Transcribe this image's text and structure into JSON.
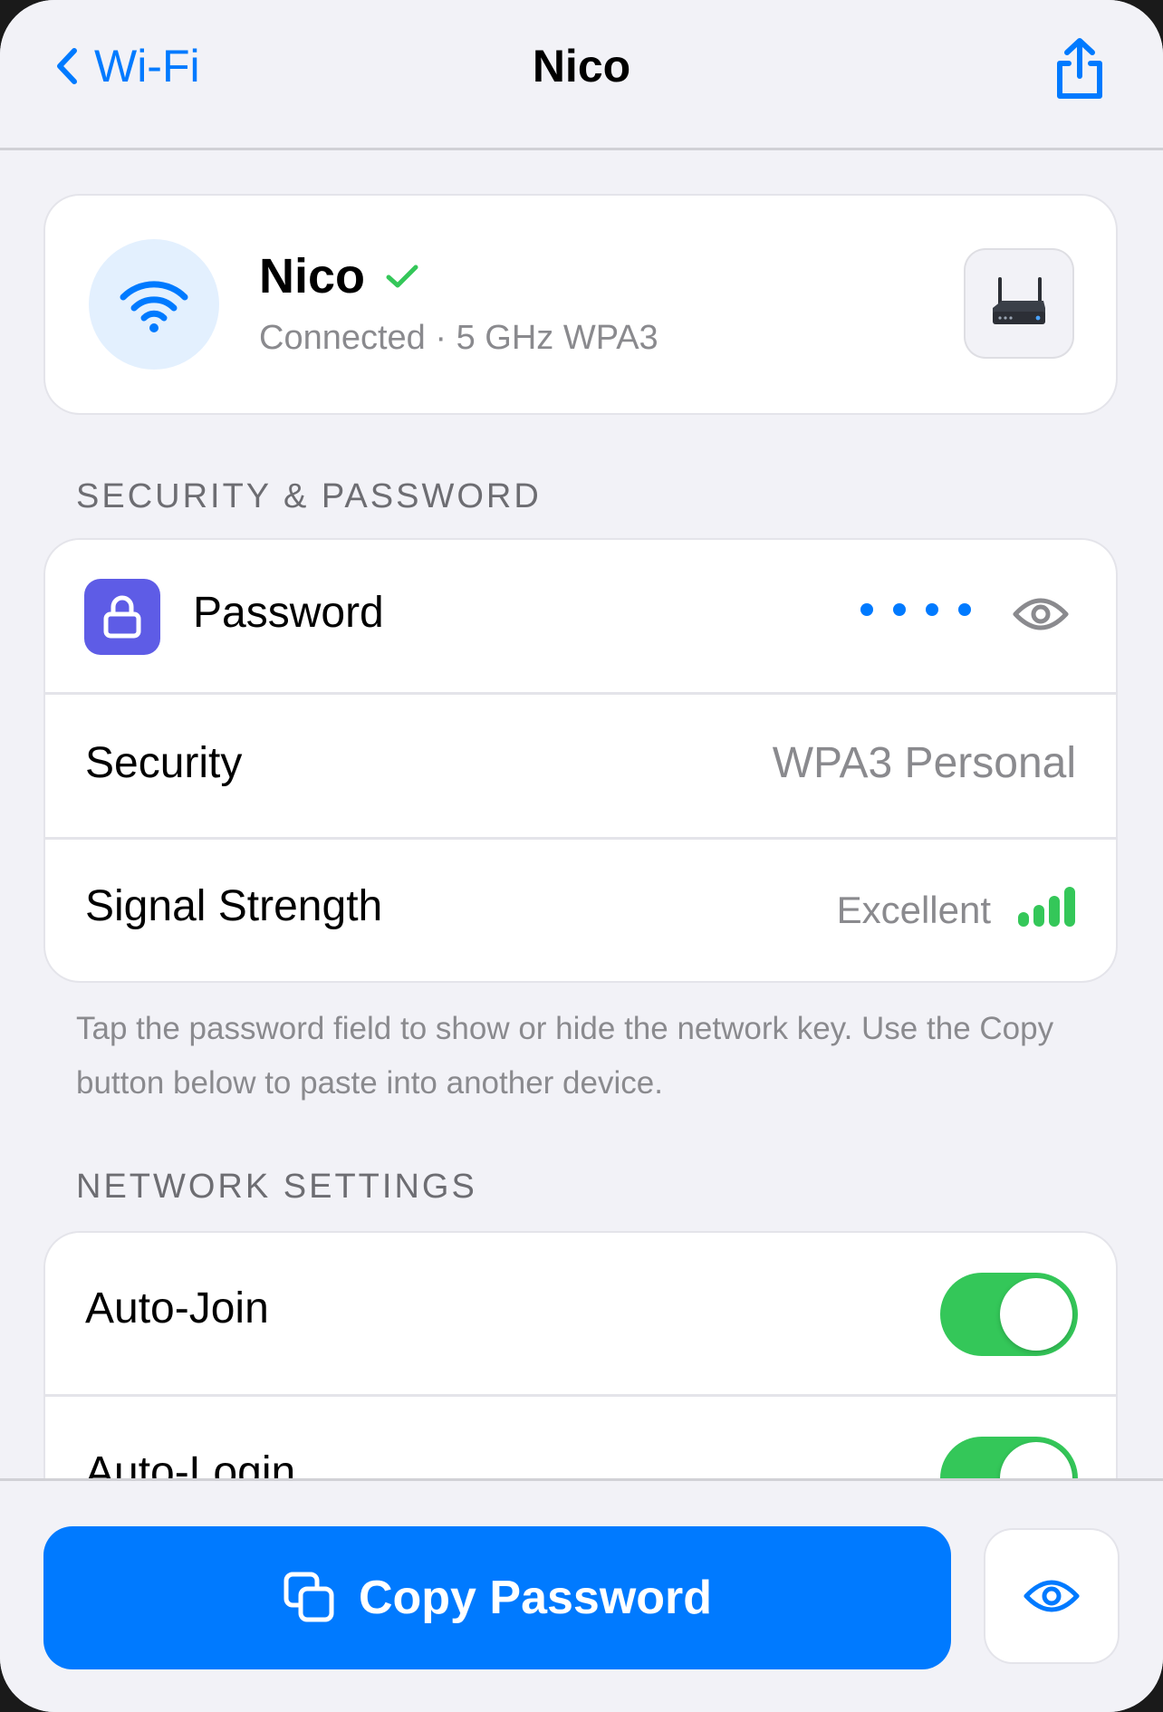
{
  "nav": {
    "back_label": "Wi-Fi",
    "title": "Nico"
  },
  "network": {
    "name": "Nico",
    "subtitle": "Connected · 5 GHz WPA3"
  },
  "security_section": {
    "title": "SECURITY & PASSWORD",
    "password_label": "Password",
    "security_label": "Security",
    "security_value": "WPA3 Personal",
    "signal_label": "Signal Strength",
    "signal_value": "Excellent",
    "signal_bars": 4,
    "footnote": "Tap the password field to show or hide the network key. Use the Copy button below to paste into another device."
  },
  "network_section": {
    "title": "NETWORK SETTINGS",
    "auto_join_label": "Auto-Join",
    "auto_join_on": true,
    "auto_login_label": "Auto-Login",
    "auto_login_on": true
  },
  "bottom": {
    "copy_label": "Copy Password"
  },
  "colors": {
    "accent": "#007aff",
    "success": "#34c759",
    "lock_tile": "#5e5ce6",
    "background": "#f2f2f7"
  },
  "icons": [
    "chevron-left-icon",
    "share-icon",
    "wifi-icon",
    "checkmark-icon",
    "router-icon",
    "lock-icon",
    "eye-icon",
    "signal-bars-icon",
    "copy-icon"
  ]
}
